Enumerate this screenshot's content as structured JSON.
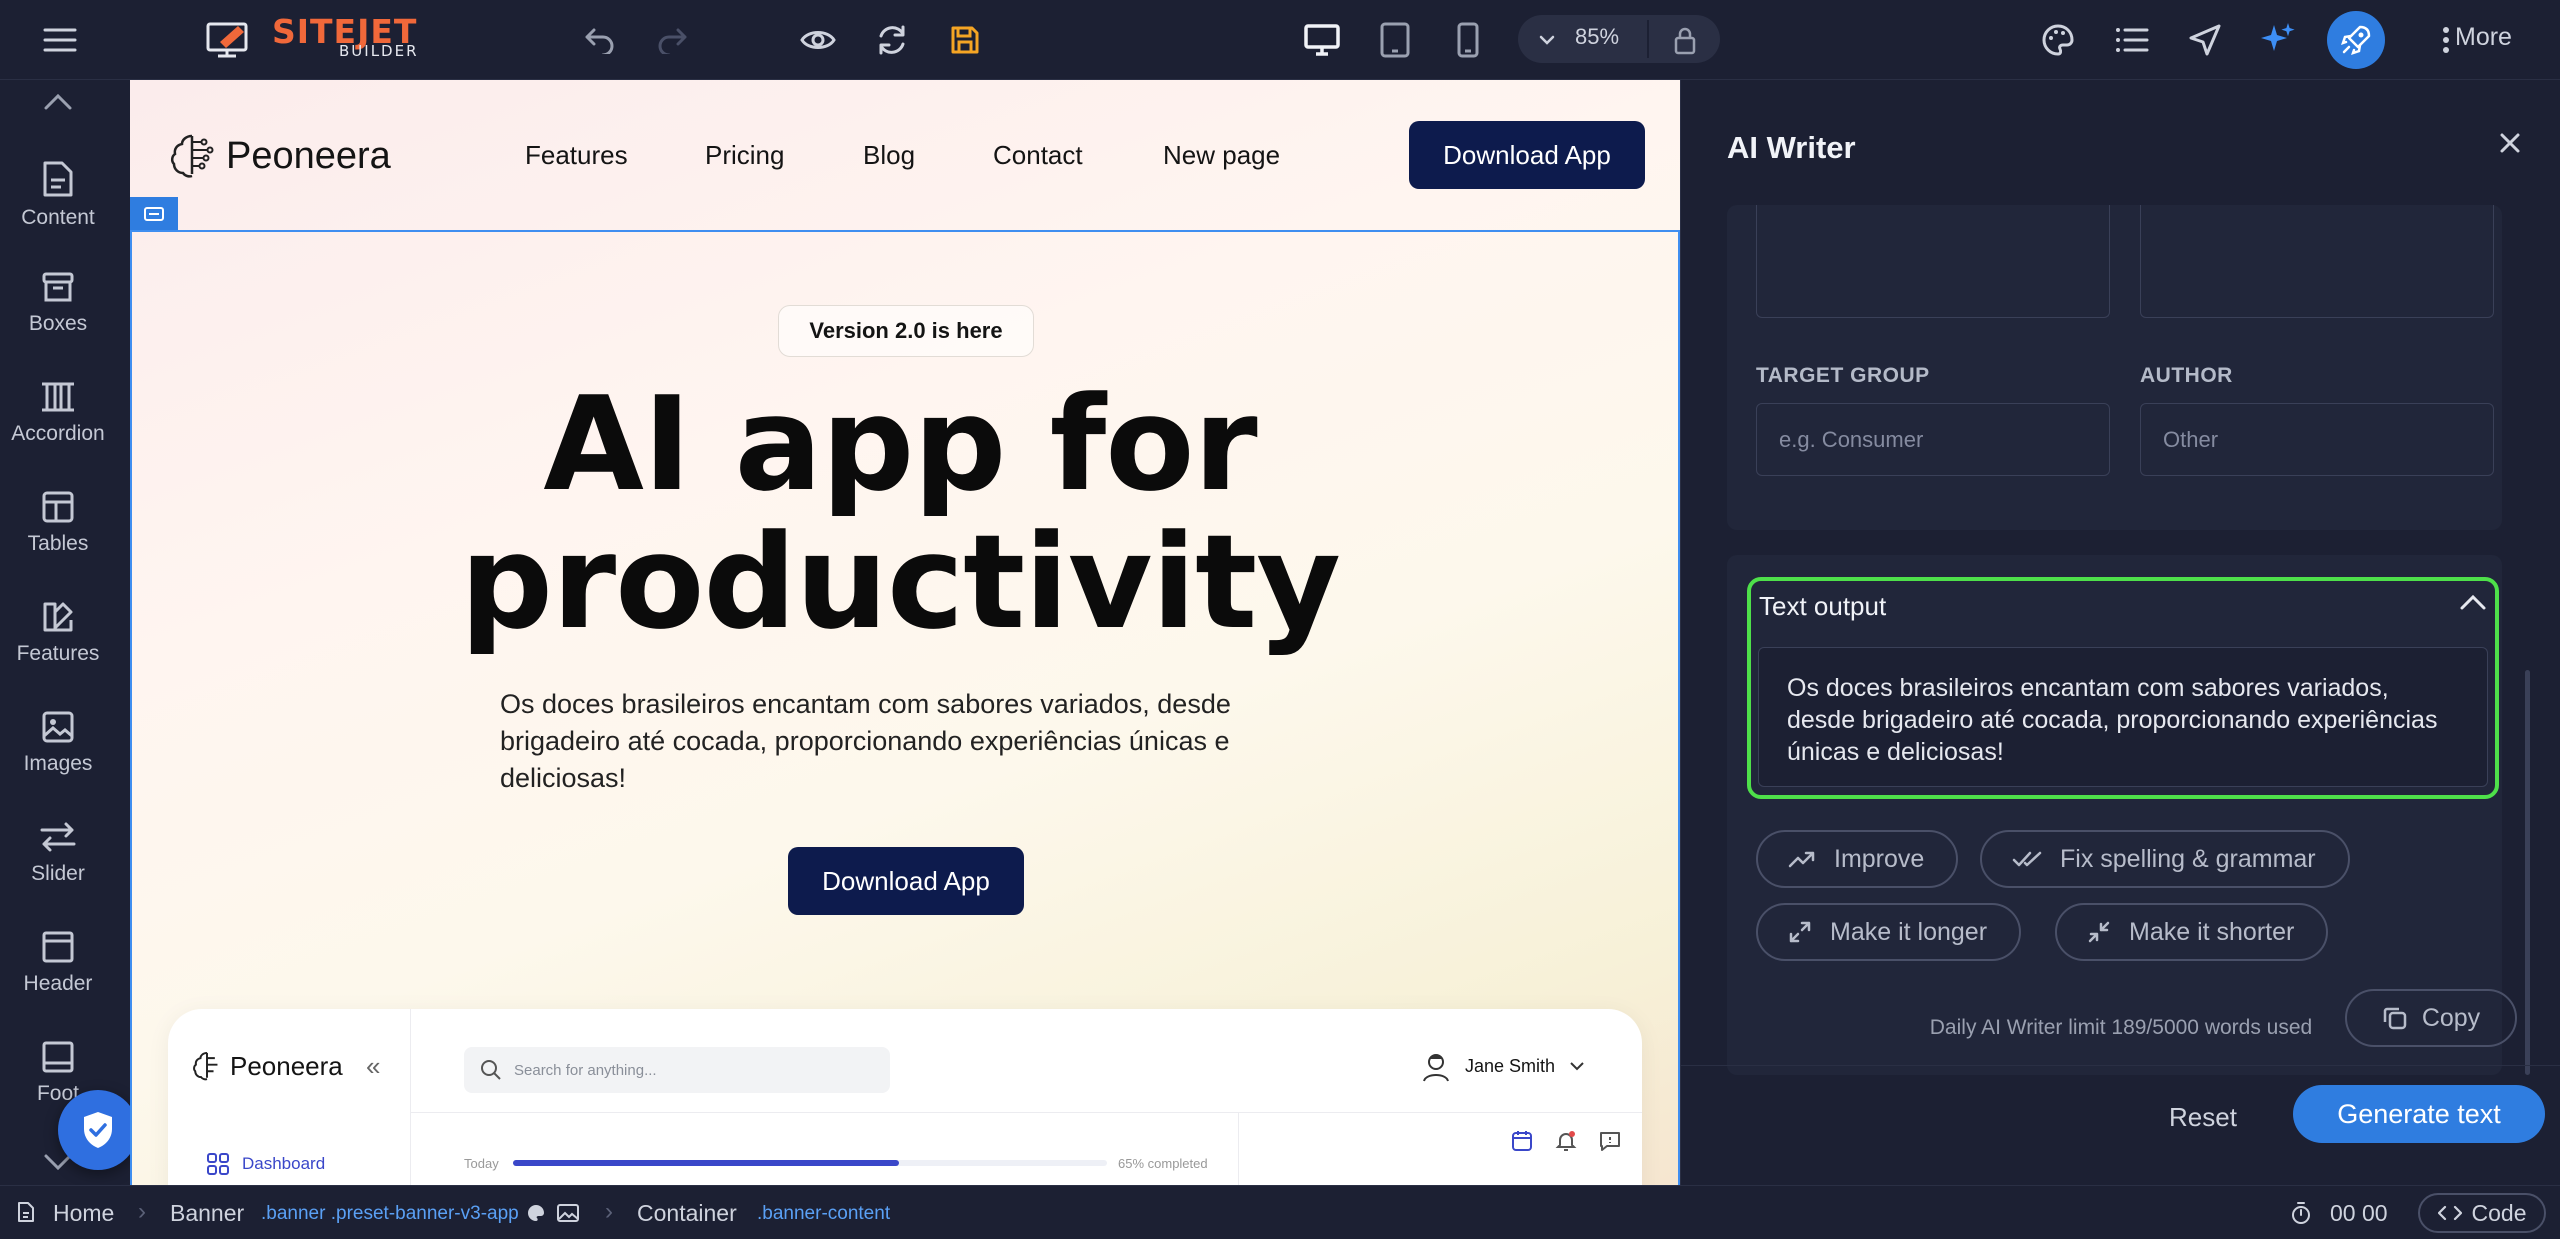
{
  "topbar": {
    "logo_text": "SITEJET",
    "logo_sub": "BUILDER",
    "zoom": "85%",
    "more_label": "More"
  },
  "sidebar": {
    "items": [
      {
        "label": "Content",
        "icon": "content-icon"
      },
      {
        "label": "Boxes",
        "icon": "boxes-icon"
      },
      {
        "label": "Accordion",
        "icon": "accordion-icon"
      },
      {
        "label": "Tables",
        "icon": "tables-icon"
      },
      {
        "label": "Features",
        "icon": "features-icon"
      },
      {
        "label": "Images",
        "icon": "images-icon"
      },
      {
        "label": "Slider",
        "icon": "slider-icon"
      },
      {
        "label": "Header",
        "icon": "header-icon"
      },
      {
        "label": "Foot",
        "icon": "footer-icon"
      }
    ]
  },
  "site": {
    "brand": "Peoneera",
    "nav": [
      "Features",
      "Pricing",
      "Blog",
      "Contact",
      "New page"
    ],
    "nav_cta": "Download App",
    "badge": "Version 2.0 is here",
    "title_line1": "AI app for",
    "title_line2": "productivity",
    "subtitle": "Os doces brasileiros encantam com sabores variados, desde brigadeiro até cocada, proporcionando experiências únicas e deliciosas!",
    "cta": "Download App",
    "mock": {
      "brand": "Peoneera",
      "search_placeholder": "Search for anything...",
      "user": "Jane Smith",
      "nav_item": "Dashboard",
      "today": "Today",
      "progress": 0.65,
      "progress_label": "65% completed"
    }
  },
  "panel": {
    "title": "AI Writer",
    "target_group_label": "TARGET GROUP",
    "target_group_placeholder": "e.g. Consumer",
    "author_label": "AUTHOR",
    "author_value": "Other",
    "output_title": "Text output",
    "output_text": "Os doces brasileiros encantam com sabores variados, desde brigadeiro até cocada, proporcionando experiências únicas e deliciosas!",
    "actions": {
      "improve": "Improve",
      "fix": "Fix spelling & grammar",
      "longer": "Make it longer",
      "shorter": "Make it shorter",
      "copy": "Copy"
    },
    "limit_text": "Daily AI Writer limit 189/5000 words used",
    "reset": "Reset",
    "generate": "Generate text"
  },
  "bottombar": {
    "home": "Home",
    "banner": "Banner",
    "banner_classes": ".banner .preset-banner-v3-app",
    "container": "Container",
    "container_classes": ".banner-content",
    "timer": "00 00",
    "code": "Code"
  },
  "colors": {
    "brand_orange": "#f0683a",
    "accent_blue": "#2f7de0",
    "output_highlight": "#4ee04a",
    "site_navy": "#0d1b4d"
  }
}
